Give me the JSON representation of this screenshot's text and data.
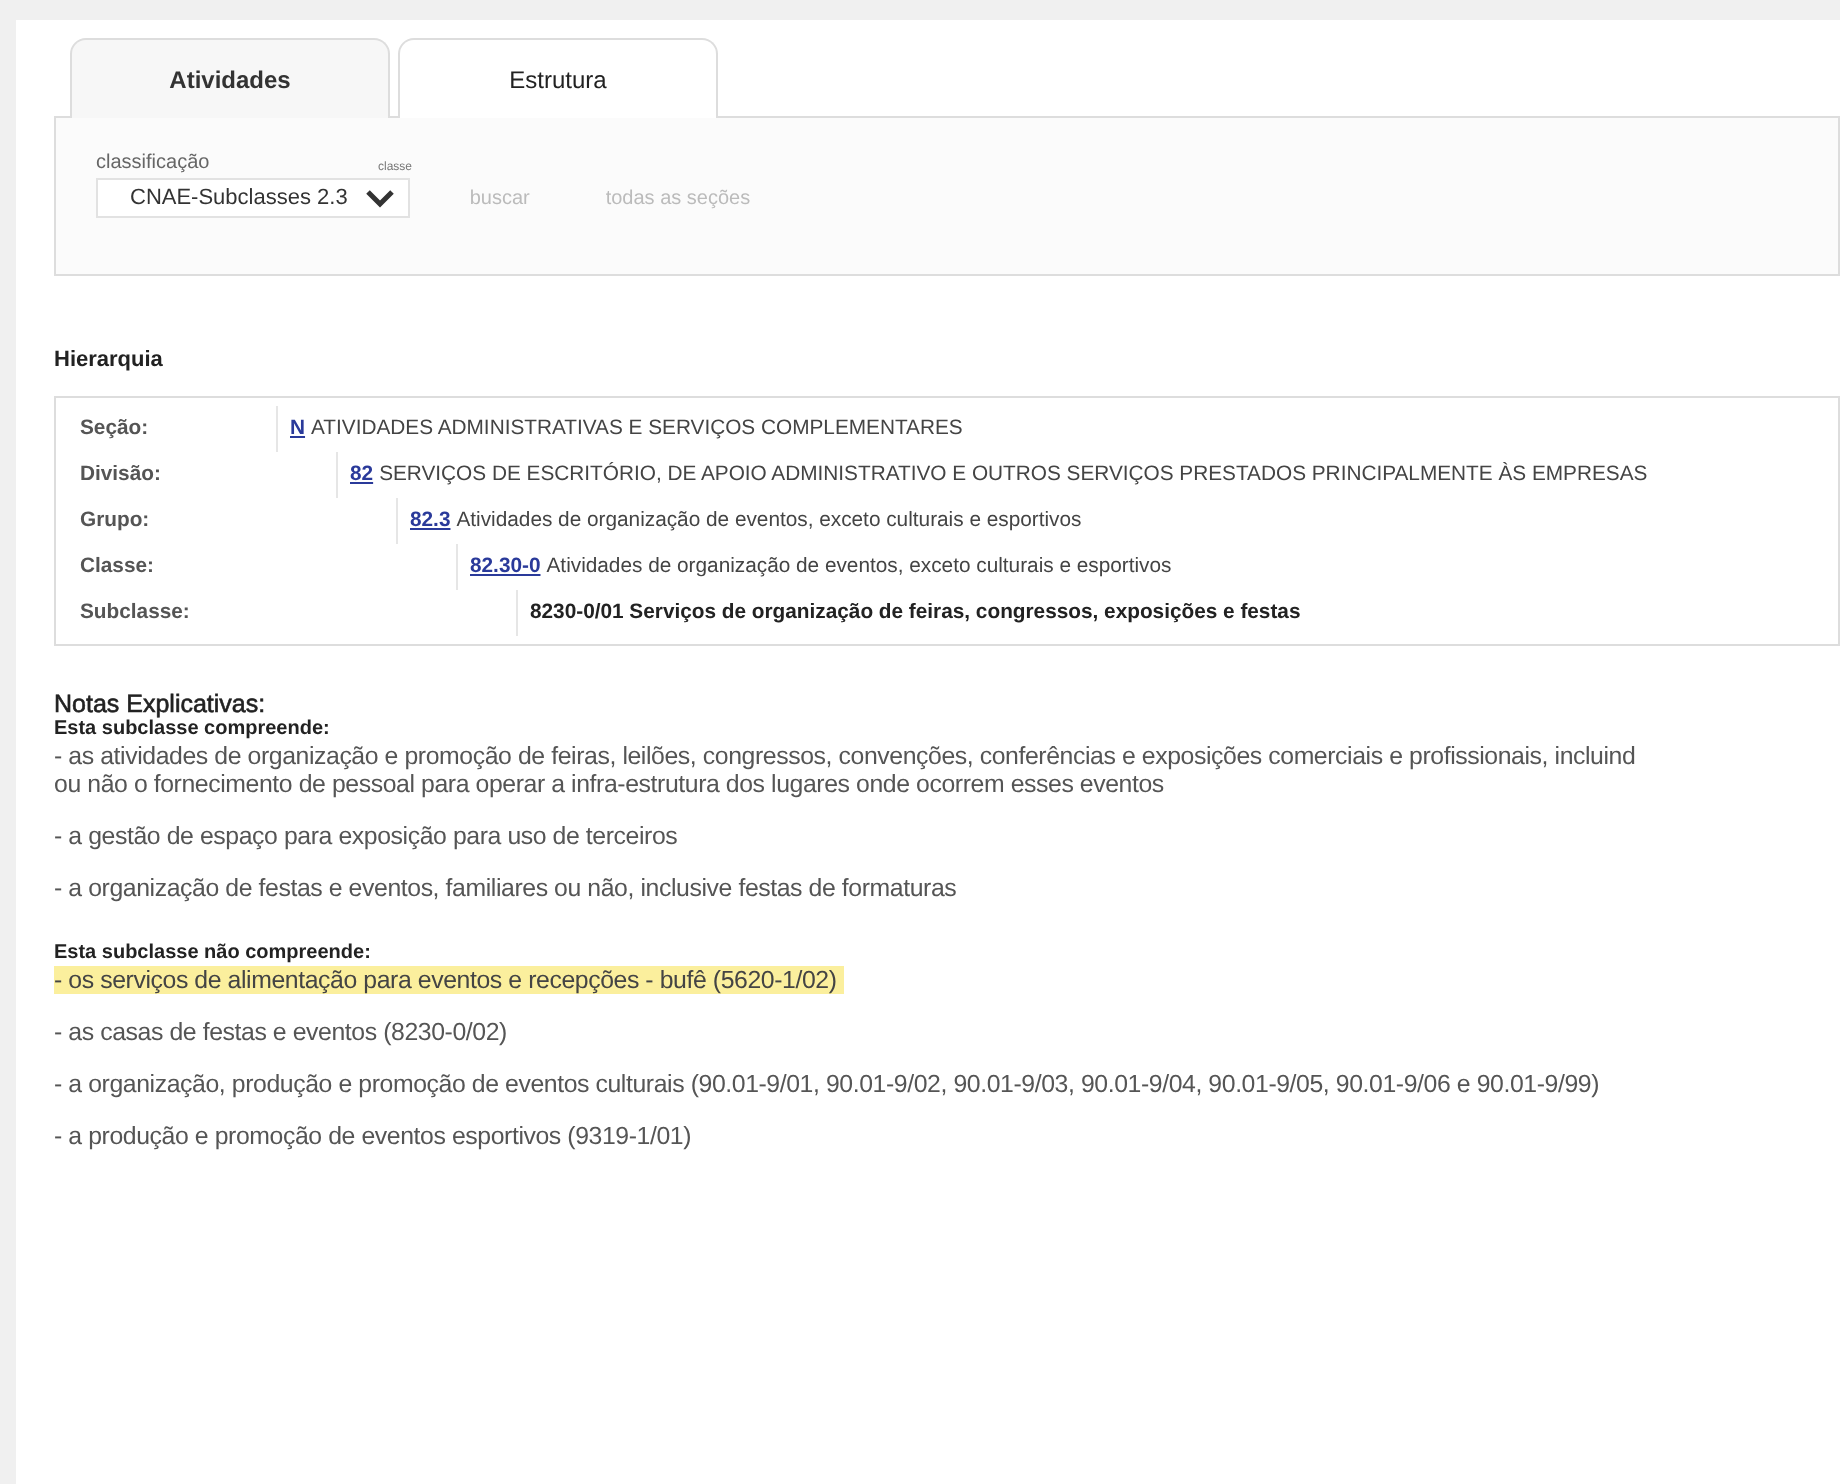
{
  "tabs": [
    {
      "label": "Atividades",
      "selected": false
    },
    {
      "label": "Estrutura",
      "selected": true
    }
  ],
  "search": {
    "label": "classificação",
    "select_value": "CNAE-Subclasses 2.3",
    "select_hint": "classe",
    "buttons": [
      {
        "label": "buscar",
        "disabled": true
      },
      {
        "label": "todas as seções",
        "disabled": true
      }
    ]
  },
  "hierarchy": {
    "title": "Hierarquia",
    "levels": [
      {
        "label": "Seção:",
        "code": "N",
        "text": "ATIVIDADES ADMINISTRATIVAS E SERVIÇOS COMPLEMENTARES",
        "children": [
          {
            "label": "Divisão:",
            "code": "82",
            "text": "SERVIÇOS DE ESCRITÓRIO, DE APOIO ADMINISTRATIVO E OUTROS SERVIÇOS PRESTADOS PRINCIPALMENTE ÀS EMPRESAS",
            "children": [
              {
                "label": "Grupo:",
                "code": "82.3",
                "text": "Atividades de organização de eventos, exceto culturais e esportivos",
                "children": [
                  {
                    "label": "Classe:",
                    "code": "82.30-0",
                    "text": "Atividades de organização de eventos, exceto culturais e esportivos",
                    "children": [
                      {
                        "label": "Subclasse:",
                        "text": "8230-0/01 Serviços de organização de feiras, congressos, exposições e festas",
                        "current": true
                      }
                    ]
                  }
                ]
              }
            ]
          }
        ]
      }
    ]
  },
  "notes": {
    "title": "Notas Explicativas:",
    "sections": [
      {
        "heading": "Esta subclasse compreende:",
        "items": [
          {
            "lines": [
              "- as atividades de organização e promoção de feiras, leilões, congressos, convenções, conferências e exposições comerciais e profissionais, incluind",
              "ou não o fornecimento de pessoal para operar a infra-estrutura dos lugares onde ocorrem esses eventos"
            ],
            "highlighted": false
          },
          {
            "lines": [
              "- a gestão de espaço para exposição para uso de terceiros"
            ],
            "highlighted": false
          },
          {
            "lines": [
              "- a organização de festas e eventos, familiares ou não, inclusive festas de formaturas"
            ],
            "highlighted": false
          }
        ]
      },
      {
        "heading": "Esta subclasse não compreende:",
        "items": [
          {
            "lines": [
              "- os serviços de alimentação para eventos e recepções - bufê (5620-1/02)"
            ],
            "highlighted": true
          },
          {
            "lines": [
              "- as casas de festas e eventos (8230-0/02)"
            ],
            "highlighted": false
          },
          {
            "lines": [
              "- a organização, produção e promoção de eventos culturais (90.01-9/01, 90.01-9/02, 90.01-9/03, 90.01-9/04, 90.01-9/05, 90.01-9/06 e 90.01-9/99)"
            ],
            "highlighted": false
          },
          {
            "lines": [
              "- a produção e promoção de eventos esportivos (9319-1/01)"
            ],
            "highlighted": false
          }
        ]
      }
    ]
  }
}
